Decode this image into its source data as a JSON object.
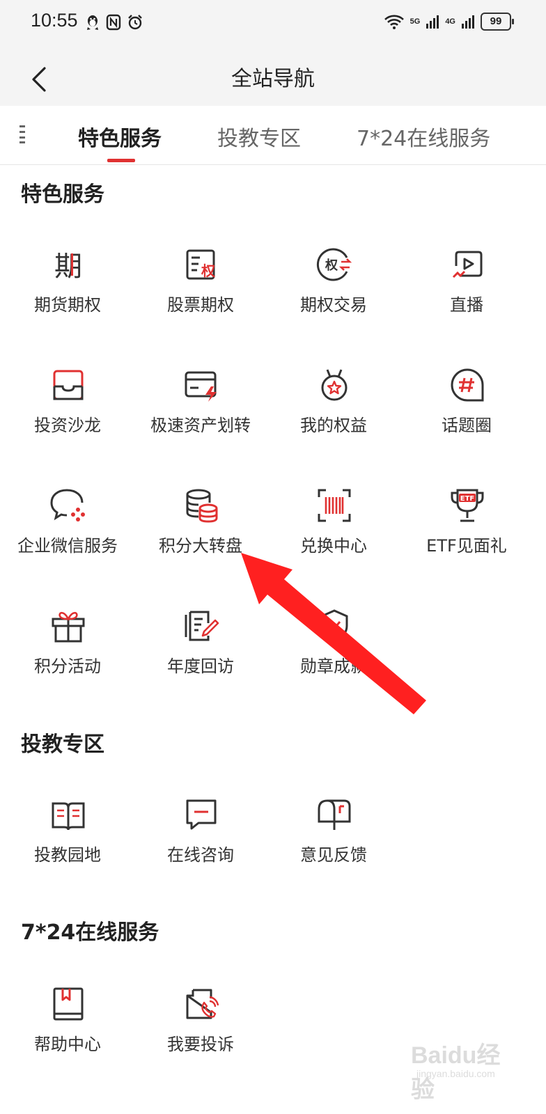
{
  "status": {
    "time": "10:55",
    "net1": "5G",
    "net2": "4G",
    "battery": "99"
  },
  "header": {
    "title": "全站导航"
  },
  "tabs": [
    {
      "label": "特色服务"
    },
    {
      "label": "投教专区"
    },
    {
      "label": "7*24在线服务"
    }
  ],
  "sections": [
    {
      "title": "特色服务",
      "items": [
        {
          "label": "期货期权",
          "icon": "futures-options-icon"
        },
        {
          "label": "股票期权",
          "icon": "stock-options-icon"
        },
        {
          "label": "期权交易",
          "icon": "options-trade-icon"
        },
        {
          "label": "直播",
          "icon": "live-broadcast-icon"
        },
        {
          "label": "投资沙龙",
          "icon": "investment-salon-icon"
        },
        {
          "label": "极速资产划转",
          "icon": "fast-asset-transfer-icon"
        },
        {
          "label": "我的权益",
          "icon": "my-benefits-medal-icon"
        },
        {
          "label": "话题圈",
          "icon": "topic-hashtag-icon"
        },
        {
          "label": "企业微信服务",
          "icon": "wechat-work-icon"
        },
        {
          "label": "积分大转盘",
          "icon": "points-wheel-coins-icon"
        },
        {
          "label": "兑换中心",
          "icon": "exchange-barcode-icon"
        },
        {
          "label": "ETF见面礼",
          "icon": "etf-trophy-icon"
        },
        {
          "label": "积分活动",
          "icon": "gift-icon"
        },
        {
          "label": "年度回访",
          "icon": "annual-review-icon"
        },
        {
          "label": "勋章成就",
          "icon": "badge-achievement-icon"
        }
      ]
    },
    {
      "title": "投教专区",
      "items": [
        {
          "label": "投教园地",
          "icon": "book-icon"
        },
        {
          "label": "在线咨询",
          "icon": "chat-bubble-icon"
        },
        {
          "label": "意见反馈",
          "icon": "mailbox-icon"
        }
      ]
    },
    {
      "title": "7*24在线服务",
      "items": [
        {
          "label": "帮助中心",
          "icon": "help-book-icon"
        },
        {
          "label": "我要投诉",
          "icon": "complaint-phone-icon"
        }
      ]
    }
  ],
  "colors": {
    "accent": "#e03131",
    "icon_stroke": "#333333",
    "arrow": "#ff2020"
  },
  "watermark": {
    "brand": "Baidu经验",
    "url": "jingyan.baidu.com"
  }
}
